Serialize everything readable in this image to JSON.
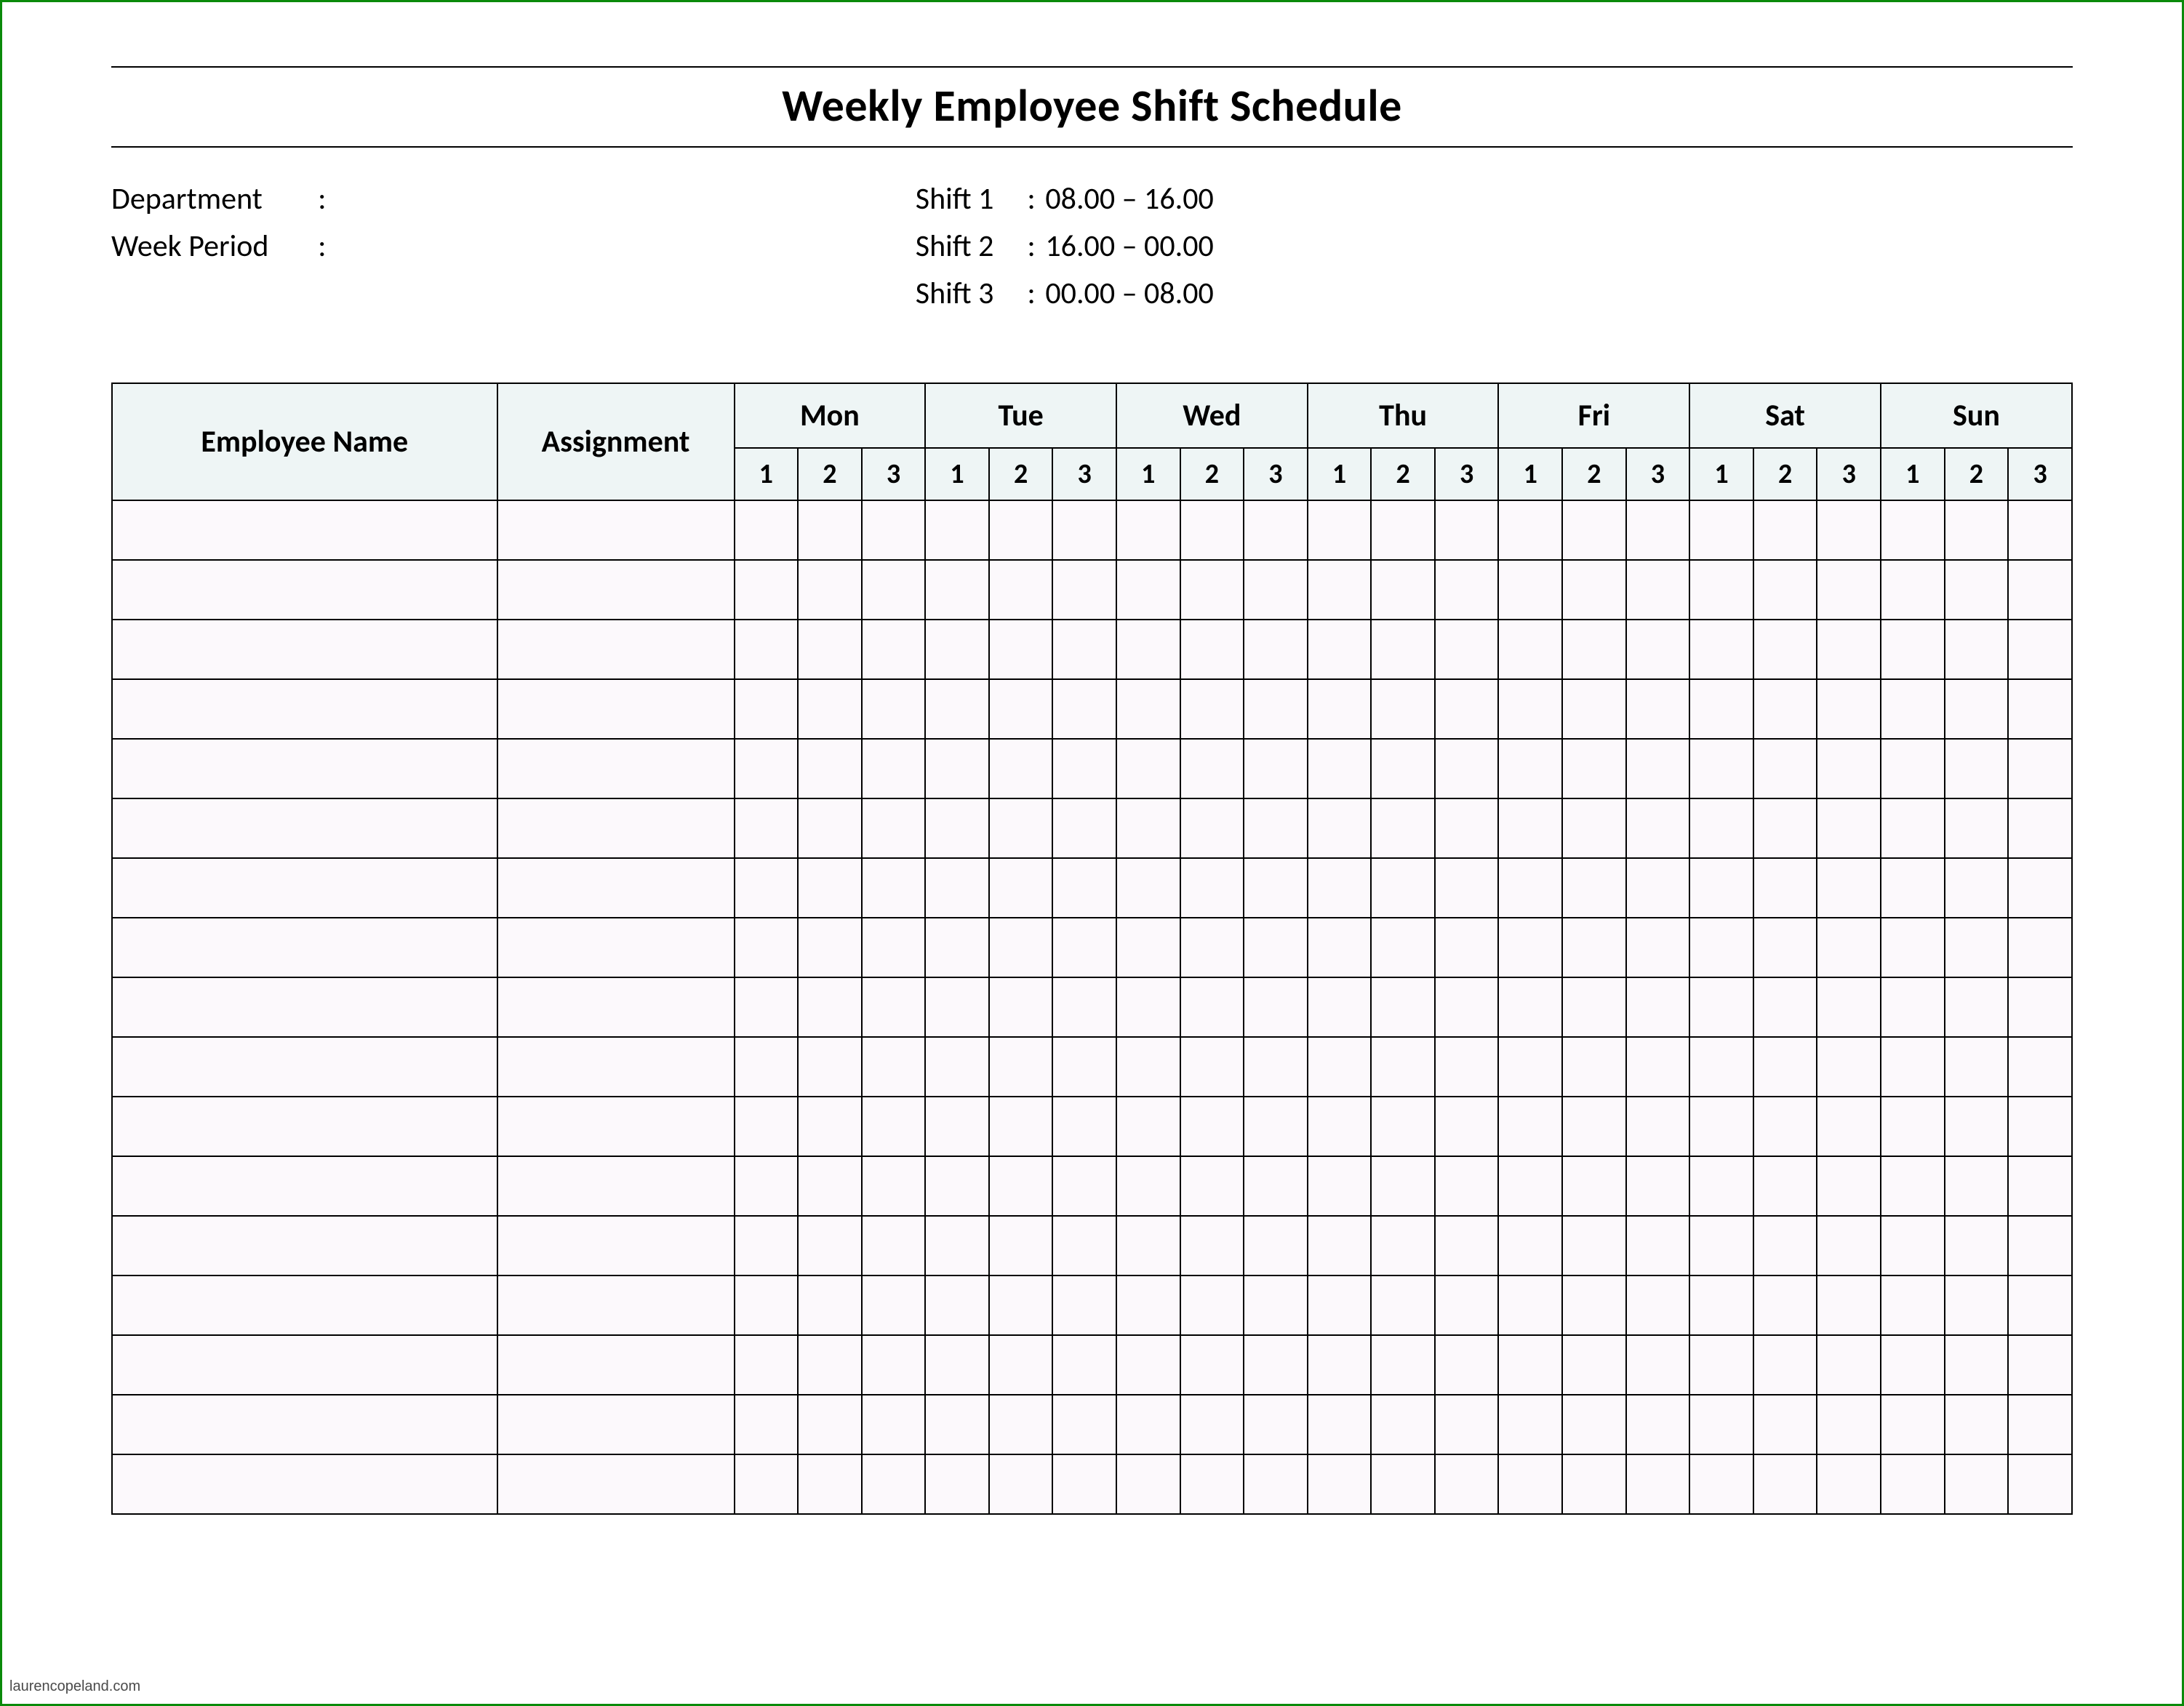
{
  "title": "Weekly Employee Shift Schedule",
  "meta": {
    "department_label": "Department",
    "department_value": "",
    "week_period_label": "Week  Period",
    "week_period_value": ""
  },
  "shifts": [
    {
      "label": "Shift 1",
      "time": "08.00  – 16.00"
    },
    {
      "label": "Shift 2",
      "time": "16.00  – 00.00"
    },
    {
      "label": "Shift 3",
      "time": "00.00  – 08.00"
    }
  ],
  "columns": {
    "employee_name": "Employee Name",
    "assignment": "Assignment",
    "days": [
      "Mon",
      "Tue",
      "Wed",
      "Thu",
      "Fri",
      "Sat",
      "Sun"
    ],
    "shift_nums": [
      "1",
      "2",
      "3"
    ]
  },
  "rows": [
    {
      "name": "",
      "assignment": "",
      "cells": [
        "",
        "",
        "",
        "",
        "",
        "",
        "",
        "",
        "",
        "",
        "",
        "",
        "",
        "",
        "",
        "",
        "",
        "",
        "",
        "",
        ""
      ]
    },
    {
      "name": "",
      "assignment": "",
      "cells": [
        "",
        "",
        "",
        "",
        "",
        "",
        "",
        "",
        "",
        "",
        "",
        "",
        "",
        "",
        "",
        "",
        "",
        "",
        "",
        "",
        ""
      ]
    },
    {
      "name": "",
      "assignment": "",
      "cells": [
        "",
        "",
        "",
        "",
        "",
        "",
        "",
        "",
        "",
        "",
        "",
        "",
        "",
        "",
        "",
        "",
        "",
        "",
        "",
        "",
        ""
      ]
    },
    {
      "name": "",
      "assignment": "",
      "cells": [
        "",
        "",
        "",
        "",
        "",
        "",
        "",
        "",
        "",
        "",
        "",
        "",
        "",
        "",
        "",
        "",
        "",
        "",
        "",
        "",
        ""
      ]
    },
    {
      "name": "",
      "assignment": "",
      "cells": [
        "",
        "",
        "",
        "",
        "",
        "",
        "",
        "",
        "",
        "",
        "",
        "",
        "",
        "",
        "",
        "",
        "",
        "",
        "",
        "",
        ""
      ]
    },
    {
      "name": "",
      "assignment": "",
      "cells": [
        "",
        "",
        "",
        "",
        "",
        "",
        "",
        "",
        "",
        "",
        "",
        "",
        "",
        "",
        "",
        "",
        "",
        "",
        "",
        "",
        ""
      ]
    },
    {
      "name": "",
      "assignment": "",
      "cells": [
        "",
        "",
        "",
        "",
        "",
        "",
        "",
        "",
        "",
        "",
        "",
        "",
        "",
        "",
        "",
        "",
        "",
        "",
        "",
        "",
        ""
      ]
    },
    {
      "name": "",
      "assignment": "",
      "cells": [
        "",
        "",
        "",
        "",
        "",
        "",
        "",
        "",
        "",
        "",
        "",
        "",
        "",
        "",
        "",
        "",
        "",
        "",
        "",
        "",
        ""
      ]
    },
    {
      "name": "",
      "assignment": "",
      "cells": [
        "",
        "",
        "",
        "",
        "",
        "",
        "",
        "",
        "",
        "",
        "",
        "",
        "",
        "",
        "",
        "",
        "",
        "",
        "",
        "",
        ""
      ]
    },
    {
      "name": "",
      "assignment": "",
      "cells": [
        "",
        "",
        "",
        "",
        "",
        "",
        "",
        "",
        "",
        "",
        "",
        "",
        "",
        "",
        "",
        "",
        "",
        "",
        "",
        "",
        ""
      ]
    },
    {
      "name": "",
      "assignment": "",
      "cells": [
        "",
        "",
        "",
        "",
        "",
        "",
        "",
        "",
        "",
        "",
        "",
        "",
        "",
        "",
        "",
        "",
        "",
        "",
        "",
        "",
        ""
      ]
    },
    {
      "name": "",
      "assignment": "",
      "cells": [
        "",
        "",
        "",
        "",
        "",
        "",
        "",
        "",
        "",
        "",
        "",
        "",
        "",
        "",
        "",
        "",
        "",
        "",
        "",
        "",
        ""
      ]
    },
    {
      "name": "",
      "assignment": "",
      "cells": [
        "",
        "",
        "",
        "",
        "",
        "",
        "",
        "",
        "",
        "",
        "",
        "",
        "",
        "",
        "",
        "",
        "",
        "",
        "",
        "",
        ""
      ]
    },
    {
      "name": "",
      "assignment": "",
      "cells": [
        "",
        "",
        "",
        "",
        "",
        "",
        "",
        "",
        "",
        "",
        "",
        "",
        "",
        "",
        "",
        "",
        "",
        "",
        "",
        "",
        ""
      ]
    },
    {
      "name": "",
      "assignment": "",
      "cells": [
        "",
        "",
        "",
        "",
        "",
        "",
        "",
        "",
        "",
        "",
        "",
        "",
        "",
        "",
        "",
        "",
        "",
        "",
        "",
        "",
        ""
      ]
    },
    {
      "name": "",
      "assignment": "",
      "cells": [
        "",
        "",
        "",
        "",
        "",
        "",
        "",
        "",
        "",
        "",
        "",
        "",
        "",
        "",
        "",
        "",
        "",
        "",
        "",
        "",
        ""
      ]
    },
    {
      "name": "",
      "assignment": "",
      "cells": [
        "",
        "",
        "",
        "",
        "",
        "",
        "",
        "",
        "",
        "",
        "",
        "",
        "",
        "",
        "",
        "",
        "",
        "",
        "",
        "",
        ""
      ]
    }
  ],
  "watermark": "laurencopeland.com"
}
